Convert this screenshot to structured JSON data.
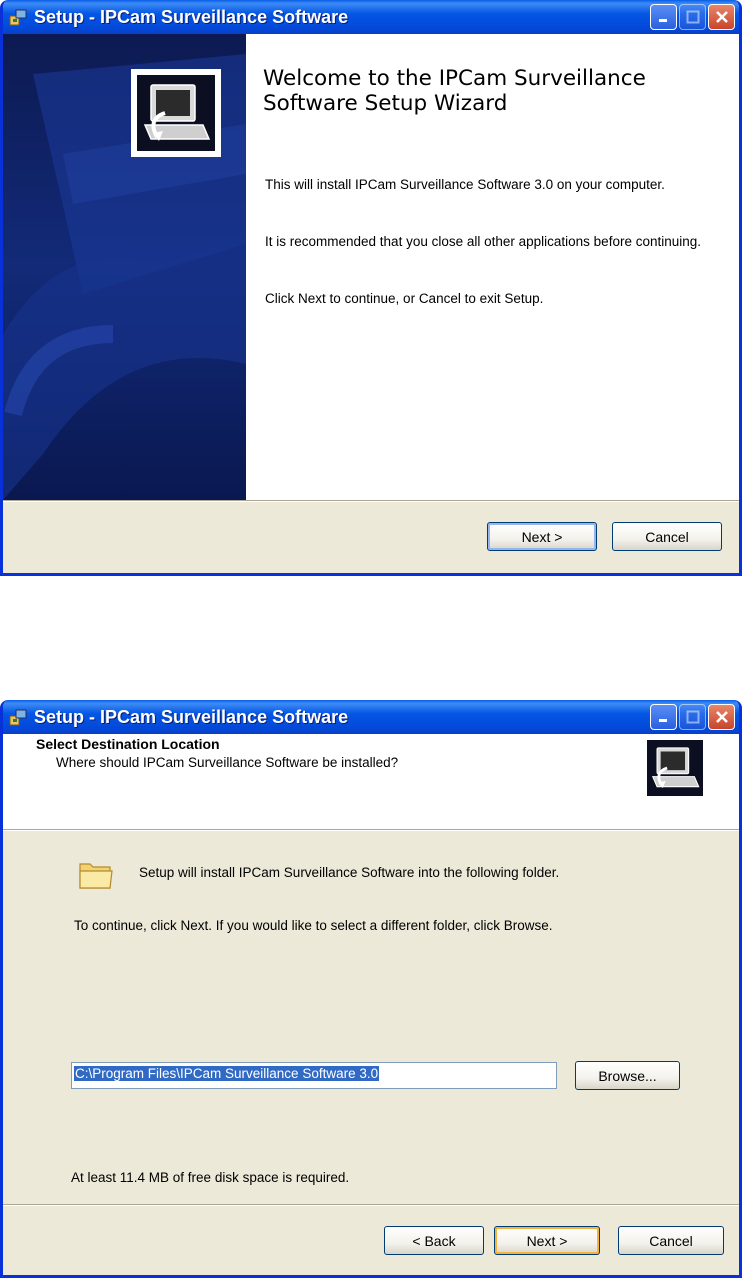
{
  "window1": {
    "title": "Setup - IPCam Surveillance Software",
    "welcome_title": "Welcome to the IPCam Surveillance Software Setup Wizard",
    "paragraphs": [
      "This will install IPCam Surveillance Software 3.0 on your computer.",
      "It is recommended that you close all other applications before continuing.",
      "Click Next to continue, or Cancel to exit Setup."
    ],
    "buttons": {
      "next": "Next >",
      "cancel": "Cancel"
    }
  },
  "window2": {
    "title": "Setup - IPCam Surveillance Software",
    "header_title": "Select Destination Location",
    "header_subtitle": "Where should IPCam Surveillance Software be installed?",
    "folder_message": "Setup will install IPCam Surveillance Software into the following folder.",
    "instruction": "To continue, click Next. If you would like to select a different folder, click Browse.",
    "install_path": "C:\\Program Files\\IPCam Surveillance Software 3.0",
    "disk_space": "At least 11.4 MB of free disk space is required.",
    "buttons": {
      "browse": "Browse...",
      "back": "< Back",
      "next": "Next >",
      "cancel": "Cancel"
    }
  }
}
